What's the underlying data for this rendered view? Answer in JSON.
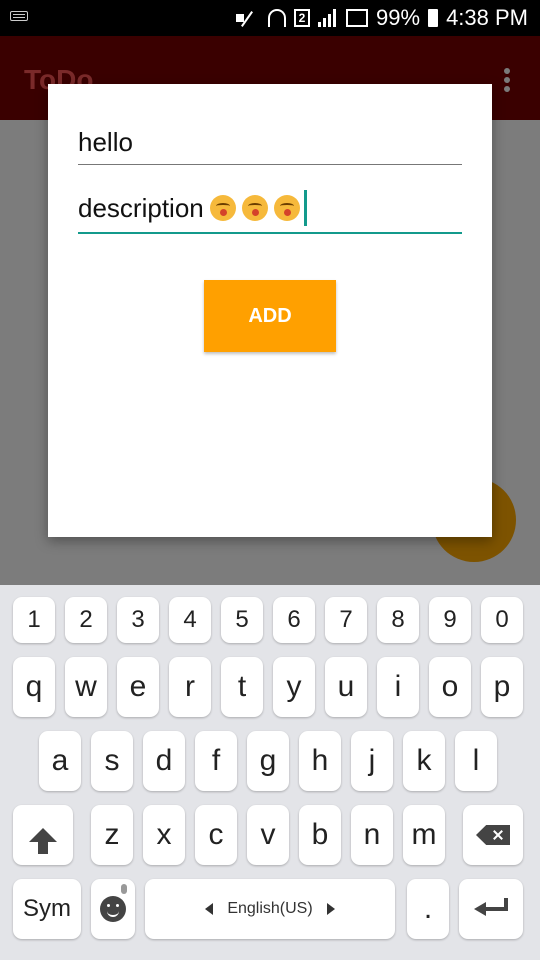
{
  "status_bar": {
    "battery_percent": "99%",
    "time": "4:38 PM",
    "sim_label": "2"
  },
  "app_bar": {
    "title": "ToDo"
  },
  "dialog": {
    "title_value": "hello",
    "description_value": "description",
    "description_emoji_count": 3,
    "add_label": "ADD"
  },
  "keyboard": {
    "number_row": [
      "1",
      "2",
      "3",
      "4",
      "5",
      "6",
      "7",
      "8",
      "9",
      "0"
    ],
    "row1": [
      "q",
      "w",
      "e",
      "r",
      "t",
      "y",
      "u",
      "i",
      "o",
      "p"
    ],
    "row2": [
      "a",
      "s",
      "d",
      "f",
      "g",
      "h",
      "j",
      "k",
      "l"
    ],
    "row3": [
      "z",
      "x",
      "c",
      "v",
      "b",
      "n",
      "m"
    ],
    "sym_label": "Sym",
    "space_label": "English(US)",
    "period_label": "."
  },
  "colors": {
    "app_bar": "#3a0000",
    "accent": "#139a8c",
    "add_button": "#ffa000"
  }
}
